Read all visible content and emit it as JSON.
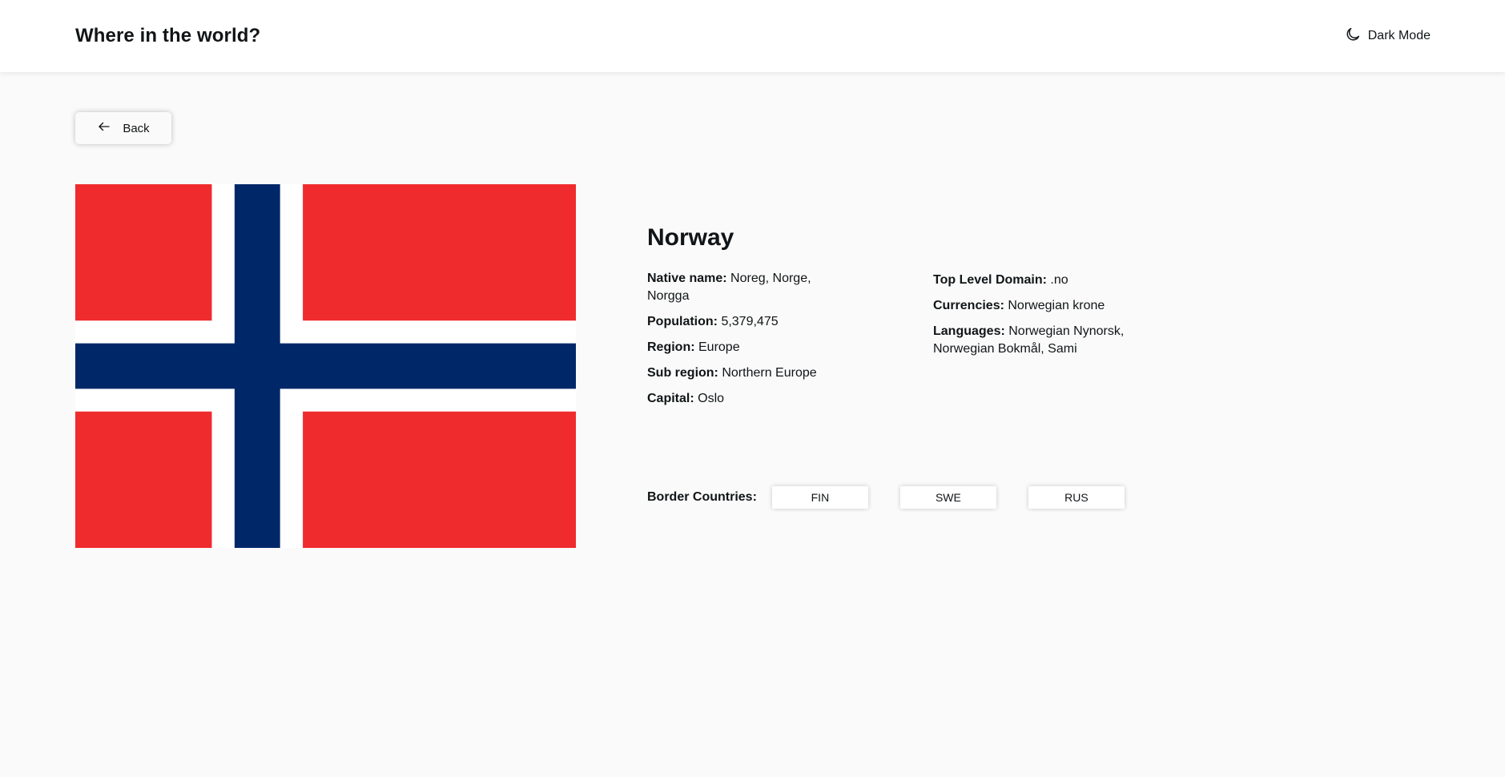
{
  "header": {
    "title": "Where in the world?",
    "dark_mode_label": "Dark Mode",
    "dark_mode_icon": "moon-icon"
  },
  "back": {
    "label": "Back",
    "icon": "arrow-left-icon"
  },
  "flag": {
    "colors": {
      "red": "#EF2B2D",
      "white": "#FFFFFF",
      "blue": "#002868"
    }
  },
  "country": {
    "name": "Norway",
    "left": [
      {
        "label": "Native name:",
        "value": "Noreg, Norge, Norgga"
      },
      {
        "label": "Population:",
        "value": "5,379,475"
      },
      {
        "label": "Region:",
        "value": "Europe"
      },
      {
        "label": "Sub region:",
        "value": "Northern Europe"
      },
      {
        "label": "Capital:",
        "value": "Oslo"
      }
    ],
    "right": [
      {
        "label": "Top Level Domain:",
        "value": ".no"
      },
      {
        "label": "Currencies:",
        "value": "Norwegian krone"
      },
      {
        "label": "Languages:",
        "value": "Norwegian Nynorsk, Norwegian Bokmål, Sami"
      }
    ]
  },
  "borders": {
    "label": "Border Countries:",
    "items": [
      "FIN",
      "SWE",
      "RUS"
    ]
  }
}
